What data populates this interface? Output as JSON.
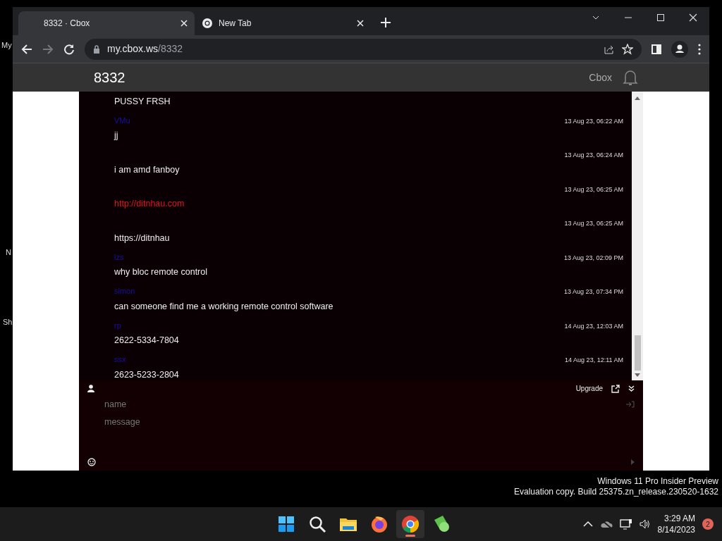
{
  "desktop_labels": [
    "My",
    "N",
    "Sh"
  ],
  "tabs": [
    {
      "label": "8332 · Cbox",
      "selected": true,
      "kind": "page"
    },
    {
      "label": "New Tab",
      "selected": false,
      "kind": "chrome"
    }
  ],
  "address": {
    "host": "my.cbox.ws",
    "path": "/8332"
  },
  "site": {
    "title": "8332",
    "brand": "Cbox"
  },
  "messages": [
    {
      "text": "PUSSY FRSH",
      "kind": "plain"
    },
    {
      "user": "VMu",
      "time": "13 Aug 23, 06:22 AM",
      "text": "jj",
      "kind": "plain"
    },
    {
      "time": "13 Aug 23, 06:24 AM",
      "text": "i am amd fanboy",
      "kind": "plain"
    },
    {
      "time": "13 Aug 23, 06:25 AM",
      "text": "http://ditnhau.com",
      "kind": "link"
    },
    {
      "time": "13 Aug 23, 06:25 AM",
      "text": "https://ditnhau",
      "kind": "plain"
    },
    {
      "user": "lzs",
      "time": "13 Aug 23, 02:09 PM",
      "text": "why bloc remote control",
      "kind": "plain"
    },
    {
      "user": "simon",
      "time": "13 Aug 23, 07:34 PM",
      "text": "can someone find me a working remote control software",
      "kind": "plain"
    },
    {
      "user": "rp",
      "time": "14 Aug 23, 12:03 AM",
      "text": "2622-5334-7804",
      "kind": "plain"
    },
    {
      "user": "ssx",
      "time": "14 Aug 23, 12:11 AM",
      "text": "2623-5233-2804",
      "kind": "plain"
    }
  ],
  "form": {
    "upgrade": "Upgrade",
    "name_placeholder": "name",
    "message_placeholder": "message"
  },
  "watermark_lines": [
    "Windows 11 Pro Insider Preview",
    "Evaluation copy. Build 25375.zn_release.230520-1632"
  ],
  "taskbar": {
    "apps": [
      {
        "kind": "start",
        "active": false
      },
      {
        "kind": "search",
        "active": false
      },
      {
        "kind": "folder",
        "active": false
      },
      {
        "kind": "firefox",
        "active": false
      },
      {
        "kind": "chrome",
        "active": true
      },
      {
        "kind": "green",
        "active": false
      }
    ],
    "time": "3:29 AM",
    "date": "8/14/2023",
    "notifications": "2"
  }
}
